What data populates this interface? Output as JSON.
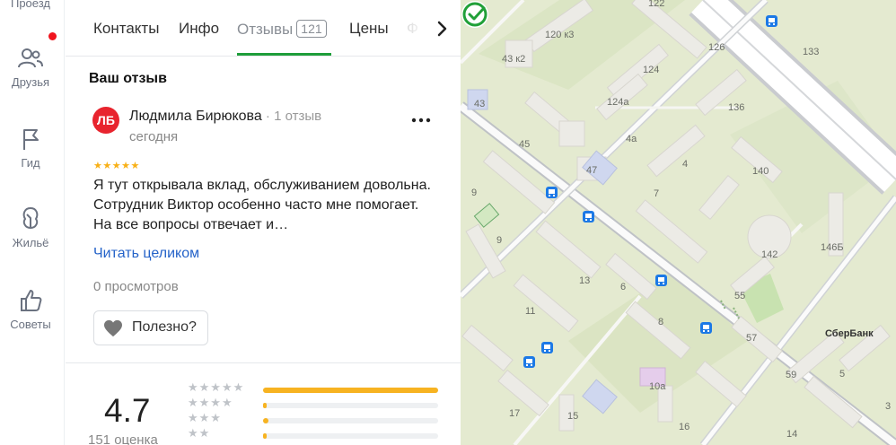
{
  "rail": {
    "items": [
      {
        "label": "Проезд",
        "icon": "route-icon"
      },
      {
        "label": "Друзья",
        "icon": "friends-icon",
        "badge": true
      },
      {
        "label": "Гид",
        "icon": "flag-icon"
      },
      {
        "label": "Жильё",
        "icon": "housing-icon"
      },
      {
        "label": "Советы",
        "icon": "thumbs-up-icon"
      }
    ]
  },
  "tabs": {
    "items": [
      {
        "label": "Контакты"
      },
      {
        "label": "Инфо"
      },
      {
        "label": "Отзывы",
        "count": "121",
        "active": true
      },
      {
        "label": "Цены"
      },
      {
        "label": "Ф"
      }
    ]
  },
  "review_section": {
    "title": "Ваш отзыв",
    "avatar_initials": "ЛБ",
    "author_name": "Людмила Бирюкова",
    "author_meta": " · 1 отзыв",
    "date": "сегодня",
    "rating_stars": 5,
    "text": "Я тут открывала вклад, обслуживанием довольна. Сотрудник Виктор особенно часто мне помогает. На все вопросы отвечает и…",
    "read_more": "Читать целиком",
    "views": "0 просмотров",
    "useful_label": "Полезно?"
  },
  "summary": {
    "rating": "4.7",
    "count_label": "151 оценка",
    "distribution": [
      {
        "stars": 5,
        "share": 1.0
      },
      {
        "stars": 4,
        "share": 0.02
      },
      {
        "stars": 3,
        "share": 0.03
      },
      {
        "stars": 2,
        "share": 0.02
      }
    ]
  },
  "colors": {
    "accent_green": "#1e9e3a",
    "star_yellow": "#f8b016",
    "link_blue": "#2563c9",
    "avatar_red": "#e8242e"
  },
  "map": {
    "labels": [
      "122",
      "120 к3",
      "126",
      "133",
      "43 к2",
      "124",
      "43",
      "124а",
      "136",
      "45",
      "4а",
      "47",
      "4",
      "140",
      "9",
      "7",
      "9",
      "142",
      "146Б",
      "13",
      "6",
      "55",
      "11",
      "8",
      "57",
      "59",
      "5",
      "10а",
      "17",
      "15",
      "16",
      "14",
      "3"
    ],
    "poi": "СберБанк",
    "poi_icon": "sberbank-logo-icon",
    "stop_icon": "bus-stop-icon"
  }
}
